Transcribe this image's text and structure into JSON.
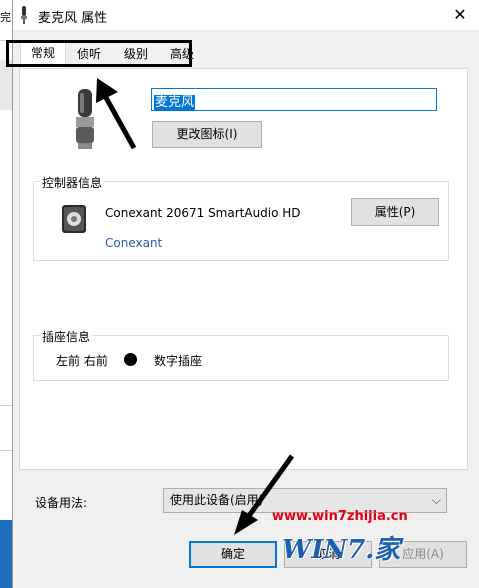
{
  "behind_window": {
    "fragment": "完"
  },
  "window": {
    "title": "麦克风 属性",
    "close_glyph": "✕"
  },
  "tabs": [
    {
      "label": "常规",
      "active": true
    },
    {
      "label": "侦听",
      "active": false
    },
    {
      "label": "级别",
      "active": false
    },
    {
      "label": "高级",
      "active": false
    }
  ],
  "device": {
    "name_value": "麦克风",
    "change_icon_label": "更改图标(I)"
  },
  "controller": {
    "group_title": "控制器信息",
    "name": "Conexant 20671 SmartAudio HD",
    "vendor": "Conexant",
    "properties_label": "属性(P)"
  },
  "jack": {
    "group_title": "插座信息",
    "position": "左前 右前",
    "type": "数字插座"
  },
  "usage": {
    "label": "设备用法:",
    "selected": "使用此设备(启用)"
  },
  "buttons": {
    "ok": "确定",
    "cancel": "取消",
    "apply": "应用(A)"
  },
  "watermark": {
    "url": "www.win7zhijia.cn",
    "logo": "WIN7.家"
  },
  "colors": {
    "accent": "#0078d7",
    "vendor_link": "#2b5aa8",
    "watermark_red": "#e60012",
    "watermark_blue": "#1f5fb0"
  }
}
